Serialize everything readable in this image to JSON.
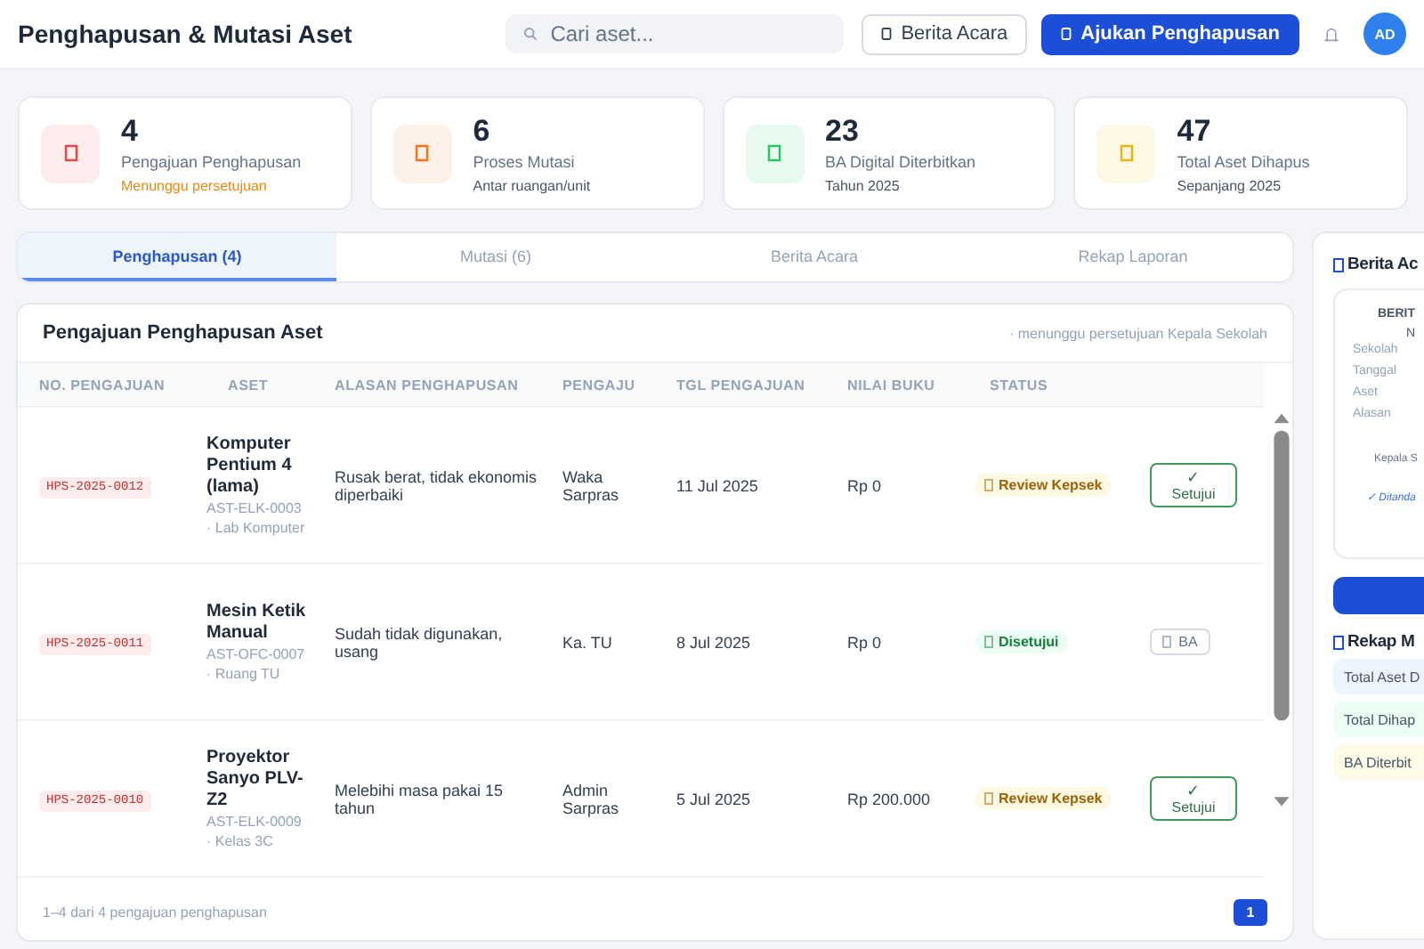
{
  "header": {
    "title": "Penghapusan & Mutasi Aset",
    "search": {
      "placeholder": "Cari aset..."
    },
    "buttons": [
      {
        "label": "Berita Acara",
        "kind": "outline"
      },
      {
        "label": "Ajukan Penghapusan",
        "kind": "primary"
      }
    ],
    "avatar": "AD"
  },
  "stats": [
    {
      "value": "4",
      "label": "Pengajuan Penghapusan",
      "note": "Menunggu persetujuan",
      "highlight": true,
      "color": "#ef4444"
    },
    {
      "value": "6",
      "label": "Proses Mutasi",
      "note": "Antar ruangan/unit",
      "highlight": false,
      "color": "#f97316"
    },
    {
      "value": "23",
      "label": "BA Digital Diterbitkan",
      "note": "Tahun 2025",
      "highlight": false,
      "color": "#22c55e"
    },
    {
      "value": "47",
      "label": "Total Aset Dihapus",
      "note": "Sepanjang 2025",
      "highlight": false,
      "color": "#eab308"
    }
  ],
  "tabs": [
    {
      "label": "Penghapusan (4)",
      "selected": true
    },
    {
      "label": "Mutasi (6)",
      "selected": false
    },
    {
      "label": "Berita Acara",
      "selected": false
    },
    {
      "label": "Rekap Laporan",
      "selected": false
    }
  ],
  "table": {
    "title": "Pengajuan Penghapusan Aset",
    "subtitle": "· menunggu persetujuan Kepala Sekolah",
    "columns": [
      "NO. PENGAJUAN",
      "ASET",
      "ALASAN PENGHAPUSAN",
      "PENGAJU",
      "TGL PENGAJUAN",
      "NILAI BUKU",
      "STATUS"
    ],
    "rows": [
      {
        "no": "HPS-2025-0012",
        "asset_name": "Komputer Pentium 4 (lama)",
        "asset_code": "AST-ELK-0003 · Lab Komputer",
        "reason": "Rusak berat, tidak ekonomis diperbaiki",
        "requester": "Waka Sarpras",
        "date": "11 Jul 2025",
        "value": "Rp 0",
        "status": {
          "label": "Review Kepsek",
          "kind": "review"
        },
        "action": {
          "mark": "✓",
          "label": "Setujui",
          "kind": "approve"
        }
      },
      {
        "no": "HPS-2025-0011",
        "asset_name": "Mesin Ketik Manual",
        "asset_code": "AST-OFC-0007 · Ruang TU",
        "reason": "Sudah tidak digunakan, usang",
        "requester": "Ka. TU",
        "date": "8 Jul 2025",
        "value": "Rp 0",
        "status": {
          "label": "Disetujui",
          "kind": "approved"
        },
        "action": {
          "label": "BA",
          "kind": "ba"
        }
      },
      {
        "no": "HPS-2025-0010",
        "asset_name": "Proyektor Sanyo PLV-Z2",
        "asset_code": "AST-ELK-0009 · Kelas 3C",
        "reason": "Melebihi masa pakai 15 tahun",
        "requester": "Admin Sarpras",
        "date": "5 Jul 2025",
        "value": "Rp 200.000",
        "status": {
          "label": "Review Kepsek",
          "kind": "review"
        },
        "action": {
          "mark": "✓",
          "label": "Setujui",
          "kind": "approve"
        }
      }
    ],
    "footer": "1–4 dari 4 pengajuan penghapusan",
    "pages": [
      {
        "label": "1",
        "selected": true
      }
    ]
  },
  "side": {
    "title": "Berita Ac",
    "preview": {
      "heading": "BERIT",
      "line": "N",
      "fields": [
        "Sekolah",
        "Tanggal",
        "Aset",
        "Alasan"
      ],
      "signer": "Kepala S",
      "signed": "✓ Ditanda"
    },
    "recap_title": "Rekap M",
    "recap": [
      {
        "label": "Total Aset D",
        "color": "#eef4ff"
      },
      {
        "label": "Total Dihap",
        "color": "#ecfdf3"
      },
      {
        "label": "BA Diterbit",
        "color": "#fefce8"
      }
    ]
  }
}
